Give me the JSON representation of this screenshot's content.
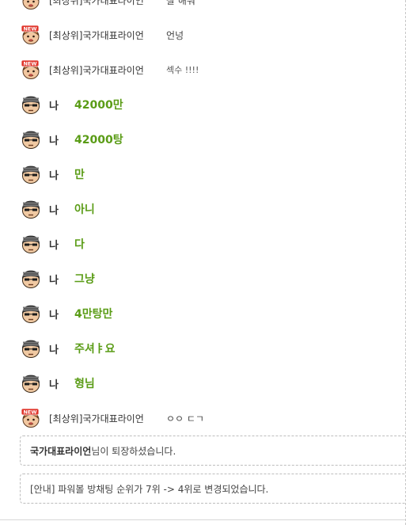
{
  "badge_text": "NEW",
  "colors": {
    "my_message": "#5a9c16",
    "text": "#444444",
    "border": "#bdbdbd"
  },
  "messages": [
    {
      "avatar": "new-user-avatar",
      "nick": "[최상위]국가대표라이언",
      "text": "잘 해줘",
      "me": false
    },
    {
      "avatar": "new-user-avatar",
      "nick": "[최상위]국가대표라이언",
      "text": "언넝",
      "me": false
    },
    {
      "avatar": "new-user-avatar",
      "nick": "[최상위]국가대표라이언",
      "text": "섹수 !!!!",
      "me": false
    },
    {
      "avatar": "my-avatar",
      "nick": "나",
      "text": "42000만",
      "me": true
    },
    {
      "avatar": "my-avatar",
      "nick": "나",
      "text": "42000탕",
      "me": true
    },
    {
      "avatar": "my-avatar",
      "nick": "나",
      "text": "만",
      "me": true
    },
    {
      "avatar": "my-avatar",
      "nick": "나",
      "text": "아니",
      "me": true
    },
    {
      "avatar": "my-avatar",
      "nick": "나",
      "text": "다",
      "me": true
    },
    {
      "avatar": "my-avatar",
      "nick": "나",
      "text": "그냥",
      "me": true
    },
    {
      "avatar": "my-avatar",
      "nick": "나",
      "text": "4만탕만",
      "me": true
    },
    {
      "avatar": "my-avatar",
      "nick": "나",
      "text": "주셔ㅑ요",
      "me": true
    },
    {
      "avatar": "my-avatar",
      "nick": "나",
      "text": "형님",
      "me": true
    },
    {
      "avatar": "new-user-avatar",
      "nick": "[최상위]국가대표라이언",
      "text": "ㅇㅇ ㄷㄱ",
      "me": false
    }
  ],
  "notices": {
    "leave": {
      "name": "국가대표라이언",
      "rest": "님이 퇴장하셨습니다."
    },
    "rank": "[안내] 파워볼 방채팅 순위가 7위 -> 4위로 변경되었습니다."
  }
}
